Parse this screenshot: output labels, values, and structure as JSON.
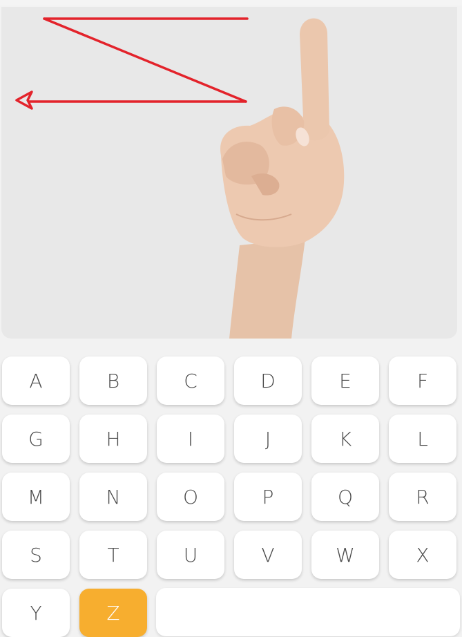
{
  "keyboard": {
    "keys": [
      "A",
      "B",
      "C",
      "D",
      "E",
      "F",
      "G",
      "H",
      "I",
      "J",
      "K",
      "L",
      "M",
      "N",
      "O",
      "P",
      "Q",
      "R",
      "S",
      "T",
      "U",
      "V",
      "W",
      "X",
      "Y",
      "Z"
    ],
    "selected": "Z"
  },
  "colors": {
    "arrow": "#e3232b",
    "selected_key": "#f7ae2f",
    "image_background": "#e8e8e8"
  }
}
